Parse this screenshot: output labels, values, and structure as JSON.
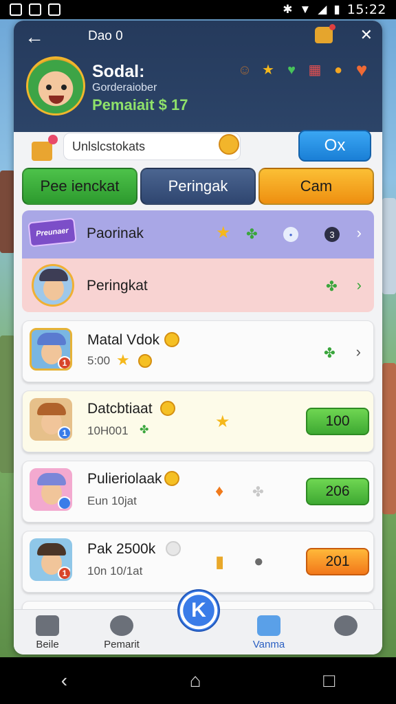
{
  "status_bar": {
    "time": "15:22"
  },
  "header": {
    "title": "Dao 0",
    "name": "Sodal:",
    "subtitle": "Gorderaiober",
    "score": "Pemaiait $ 17"
  },
  "search": {
    "value": "Unlslcstokats",
    "ok_label": "Ox"
  },
  "tabs": [
    {
      "label": "Pee ienckat"
    },
    {
      "label": "Peringak"
    },
    {
      "label": "Cam"
    }
  ],
  "rows": {
    "purple": {
      "tag": "Preunaer",
      "name": "Paorinak",
      "count": "3"
    },
    "pink": {
      "name": "Peringkat"
    },
    "r1": {
      "name": "Matal Vdok",
      "sub": "5:00",
      "badge": "1"
    },
    "r2": {
      "name": "Datcbtiaat",
      "sub": "10H001",
      "badge": "1",
      "score": "100"
    },
    "r3": {
      "name": "Pulieriolaak",
      "sub": "Eun 10jat",
      "score": "206"
    },
    "r4": {
      "name": "Pak 2500k",
      "sub": "10n 10/1at",
      "badge": "1",
      "score": "201"
    }
  },
  "bottom_nav": {
    "items": [
      "Beile",
      "Pemarit",
      "Vanma"
    ],
    "center": "K"
  },
  "colors": {
    "header": "#253a5c",
    "green": "#3ea932",
    "orange": "#f2781a",
    "blue": "#1a7fd6"
  }
}
